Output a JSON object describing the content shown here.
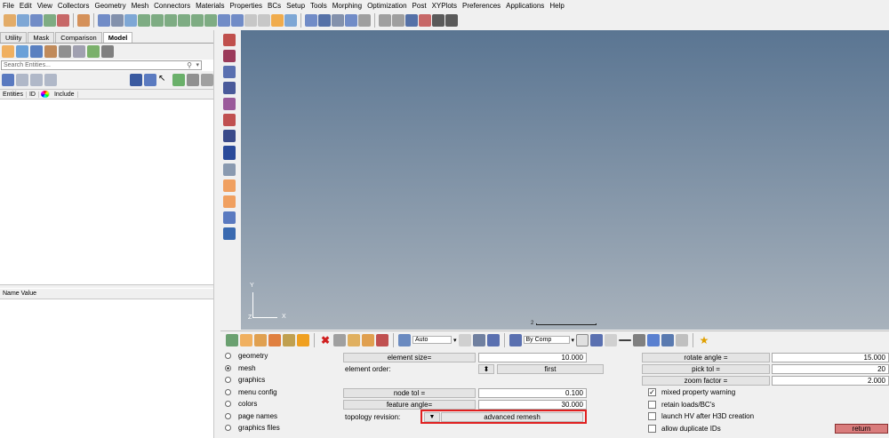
{
  "menu": [
    "File",
    "Edit",
    "View",
    "Collectors",
    "Geometry",
    "Mesh",
    "Connectors",
    "Materials",
    "Properties",
    "BCs",
    "Setup",
    "Tools",
    "Morphing",
    "Optimization",
    "Post",
    "XYPlots",
    "Preferences",
    "Applications",
    "Help"
  ],
  "browser": {
    "tabs": [
      "Utility",
      "Mask",
      "Comparison",
      "Model"
    ],
    "active_tab": "Model",
    "search_placeholder": "Search Entities...",
    "columns": [
      "Entities",
      "ID",
      "Include"
    ],
    "props_header": "Name Value"
  },
  "viewport": {
    "axis_y": "Y",
    "axis_z": "Z",
    "axis_x": "X",
    "scale_label": "2"
  },
  "bottom_toolbar": {
    "display_mode": "Auto",
    "color_mode": "By Comp"
  },
  "panel": {
    "radios": [
      {
        "label": "geometry",
        "selected": false
      },
      {
        "label": "mesh",
        "selected": true
      },
      {
        "label": "graphics",
        "selected": false
      },
      {
        "label": "menu config",
        "selected": false
      },
      {
        "label": "colors",
        "selected": false
      },
      {
        "label": "page names",
        "selected": false
      },
      {
        "label": "graphics files",
        "selected": false
      }
    ],
    "element_size_label": "element size=",
    "element_size_value": "10.000",
    "element_order_label": "element order:",
    "element_order_value": "first",
    "element_order_arrow": "⬍",
    "node_tol_label": "node tol =",
    "node_tol_value": "0.100",
    "feature_angle_label": "feature angle=",
    "feature_angle_value": "30.000",
    "topology_label": "topology revision:",
    "topology_value": "advanced remesh",
    "rotate_angle_label": "rotate angle =",
    "rotate_angle_value": "15.000",
    "pick_tol_label": "pick tol =",
    "pick_tol_value": "20",
    "zoom_factor_label": "zoom factor =",
    "zoom_factor_value": "2.000",
    "checks": [
      {
        "label": "mixed property warning",
        "checked": true
      },
      {
        "label": "retain loads/BC's",
        "checked": false
      },
      {
        "label": "launch HV after H3D creation",
        "checked": false
      },
      {
        "label": "allow duplicate IDs",
        "checked": false
      }
    ],
    "return_label": "return"
  }
}
